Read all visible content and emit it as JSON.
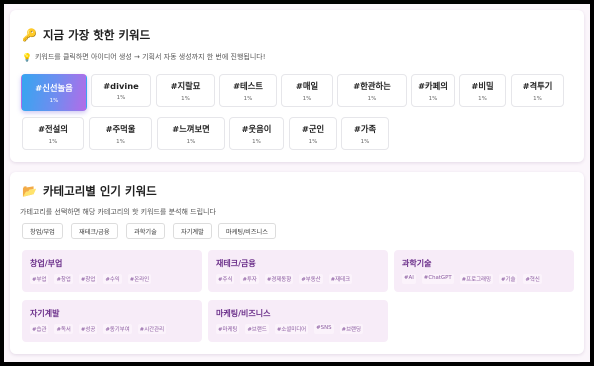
{
  "trending": {
    "title": "지금 가장 핫한 키워드",
    "subtitle": "키워드를 클릭하면 아이디어 생성 → 기획서 자동 생성까지 한 번에 진행됩니다!",
    "keywords": [
      {
        "word": "#신선놀음",
        "pct": "1%"
      },
      {
        "word": "#divine",
        "pct": "1%"
      },
      {
        "word": "#지랄묘",
        "pct": "1%"
      },
      {
        "word": "#테스트",
        "pct": "1%"
      },
      {
        "word": "#매일",
        "pct": "1%"
      },
      {
        "word": "#한관하는",
        "pct": "1%"
      },
      {
        "word": "#카페의",
        "pct": "1%"
      },
      {
        "word": "#비밀",
        "pct": "1%"
      },
      {
        "word": "#격투기",
        "pct": "1%"
      },
      {
        "word": "#전설의",
        "pct": "1%"
      },
      {
        "word": "#주먹울",
        "pct": "1%"
      },
      {
        "word": "#느껴보면",
        "pct": "1%"
      },
      {
        "word": "#웃음이",
        "pct": "1%"
      },
      {
        "word": "#군인",
        "pct": "1%"
      },
      {
        "word": "#가족",
        "pct": "1%"
      }
    ]
  },
  "categories": {
    "title": "카테고리별 인기 키워드",
    "subtitle": "가테고리를 선택하면 해당 카테고리의 핫 키워드를 분석해 드립니다",
    "filters": [
      "창업/부업",
      "재테크/금융",
      "과학기술",
      "자기계발",
      "마케팅/비즈니스"
    ],
    "cards": [
      {
        "name": "창업/부업",
        "tags": [
          "#부업",
          "#창업",
          "#창업",
          "#수익",
          "#온라인"
        ]
      },
      {
        "name": "재테크/금융",
        "tags": [
          "#주식",
          "#투자",
          "#경제동향",
          "#부동산",
          "#재테크"
        ]
      },
      {
        "name": "과학기술",
        "tags": [
          "#AI",
          "#ChatGPT",
          "#프로그래밍",
          "#기술",
          "#혁신"
        ]
      },
      {
        "name": "자기계발",
        "tags": [
          "#습관",
          "#독서",
          "#성공",
          "#동기부여",
          "#시간관리"
        ]
      },
      {
        "name": "마케팅/비즈니스",
        "tags": [
          "#마케팅",
          "#브랜드",
          "#소셜미디어",
          "#SNS",
          "#브랜딩"
        ]
      }
    ]
  },
  "icons": {
    "title1": "key-icon",
    "hint": "lightbulb-icon",
    "title2": "folder-icon"
  }
}
